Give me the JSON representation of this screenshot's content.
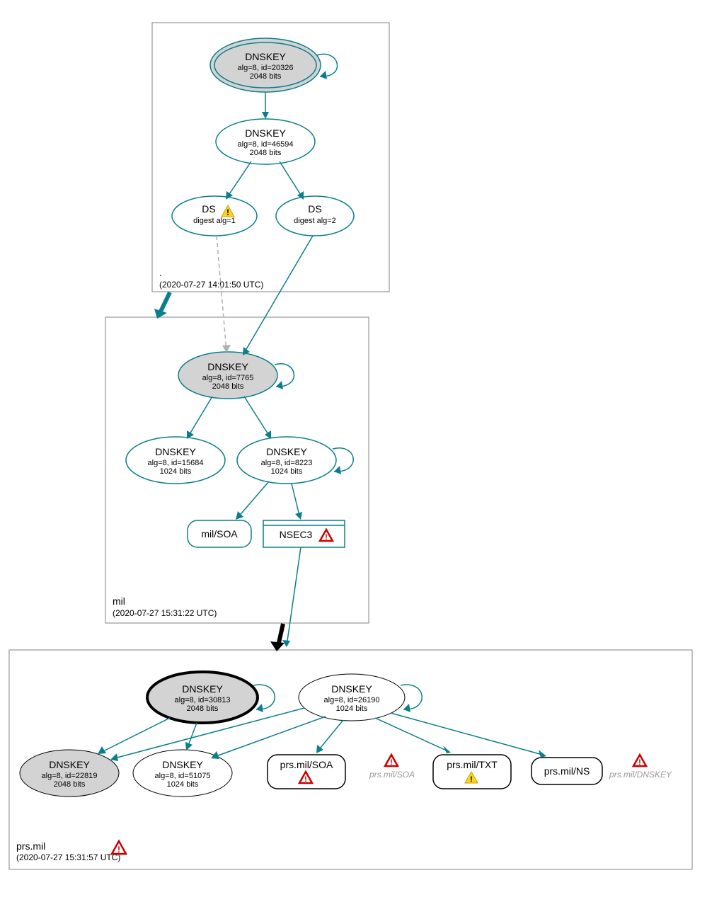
{
  "zones": {
    "root": {
      "label": ".",
      "timestamp": "(2020-07-27 14:01:50 UTC)",
      "nodes": {
        "ksk": {
          "title": "DNSKEY",
          "line1": "alg=8, id=20326",
          "line2": "2048 bits"
        },
        "zsk": {
          "title": "DNSKEY",
          "line1": "alg=8, id=46594",
          "line2": "2048 bits"
        },
        "ds1": {
          "title": "DS",
          "line1": "digest alg=1"
        },
        "ds2": {
          "title": "DS",
          "line1": "digest alg=2"
        }
      }
    },
    "mil": {
      "label": "mil",
      "timestamp": "(2020-07-27 15:31:22 UTC)",
      "nodes": {
        "ksk": {
          "title": "DNSKEY",
          "line1": "alg=8, id=7765",
          "line2": "2048 bits"
        },
        "zsk1": {
          "title": "DNSKEY",
          "line1": "alg=8, id=15684",
          "line2": "1024 bits"
        },
        "zsk2": {
          "title": "DNSKEY",
          "line1": "alg=8, id=8223",
          "line2": "1024 bits"
        },
        "soa": {
          "title": "mil/SOA"
        },
        "nsec3": {
          "title": "NSEC3"
        }
      }
    },
    "prsmil": {
      "label": "prs.mil",
      "timestamp": "(2020-07-27 15:31:57 UTC)",
      "nodes": {
        "ksk": {
          "title": "DNSKEY",
          "line1": "alg=8, id=30813",
          "line2": "2048 bits"
        },
        "key2": {
          "title": "DNSKEY",
          "line1": "alg=8, id=26190",
          "line2": "1024 bits"
        },
        "key3": {
          "title": "DNSKEY",
          "line1": "alg=8, id=22819",
          "line2": "2048 bits"
        },
        "key4": {
          "title": "DNSKEY",
          "line1": "alg=8, id=51075",
          "line2": "1024 bits"
        },
        "soa": {
          "title": "prs.mil/SOA"
        },
        "soa_ghost": {
          "title": "prs.mil/SOA"
        },
        "txt": {
          "title": "prs.mil/TXT"
        },
        "ns": {
          "title": "prs.mil/NS"
        },
        "dnskey_ghost": {
          "title": "prs.mil/DNSKEY"
        }
      }
    }
  }
}
